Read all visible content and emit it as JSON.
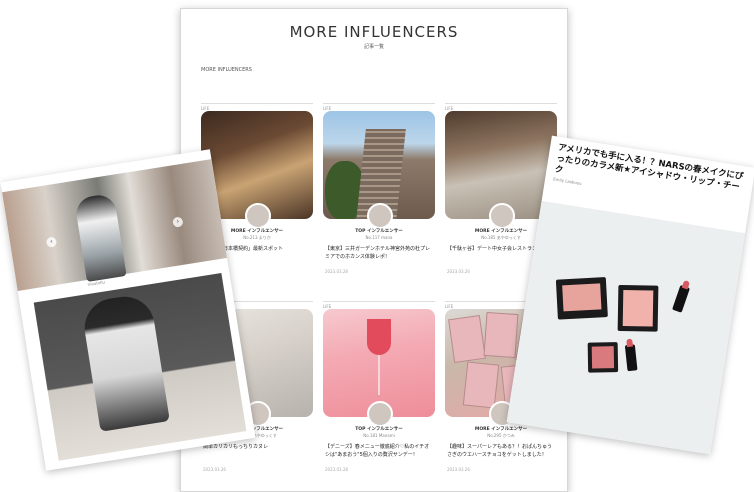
{
  "main": {
    "title": "MORE INFLUENCERS",
    "subtitle": "記事一覧",
    "breadcrumb": "MORE INFLUENCERS"
  },
  "cards": [
    {
      "tag": "LIFE",
      "rank": "MORE インフルエンサー",
      "user": "No.213 まりか",
      "headline": "ぶげる「日本橋契約」最新スポット",
      "date": ""
    },
    {
      "tag": "LIFE",
      "rank": "TOP インフルエンサー",
      "user": "No.117 mana",
      "headline": "【東京】三井ガーデンホテル神宮外苑の杜プレミアでのホカンス体験レポ！",
      "date": "2023.03.28"
    },
    {
      "tag": "LIFE",
      "rank": "MORE インフルエンサー",
      "user": "No.185 あやゆっくす",
      "headline": "【千駄ヶ谷】デート中女子会レストラン",
      "date": "2023.03.26"
    },
    {
      "tag": "LIFE",
      "rank": "MORE インフルエンサー",
      "user": "No.185 あやゆっくす",
      "headline": "簡単カリカリもっちりカヌレ",
      "date": "2023.03.26"
    },
    {
      "tag": "LIFE",
      "rank": "TOP インフルエンサー",
      "user": "No.181 Manami",
      "headline": "【デニーズ】春メニュー徹底紹介♡私のイチオシは\"あまおう\"5個入りの贅沢サンデー！",
      "date": "2023.03.28"
    },
    {
      "tag": "LIFE",
      "rank": "MORE インフルエンサー",
      "user": "No.295 かつみ",
      "headline": "【趣味】スーパーレアもある？！おぱんちゅうさぎのウエハースチョコをゲットしました！",
      "date": "2023.03.26"
    }
  ],
  "left_page": {
    "caption": "moutollu"
  },
  "right_page": {
    "title": "アメリカでも手に入る！？NARSの春メイクにぴったりのカラメ新★アイシャドウ・リップ・チーク",
    "meta": "Emily Lasbusu"
  },
  "colors": {
    "accent": "#e24b5c",
    "text": "#333333"
  }
}
